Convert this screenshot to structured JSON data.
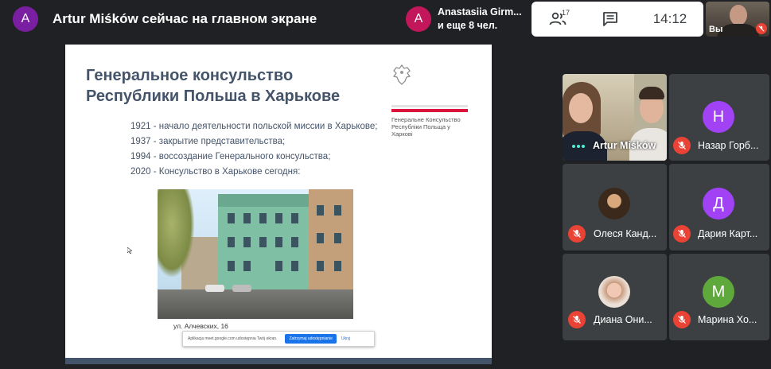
{
  "presenting": {
    "avatar_letter": "A",
    "avatar_color": "#7b1fa2",
    "label": "Artur Miśków сейчас на главном экране"
  },
  "chip": {
    "avatar_letter": "A",
    "avatar_color": "#c2185b",
    "line1": "Anastasiia Girm...",
    "line2": "и еще 8 чел."
  },
  "controls": {
    "people_count": "17",
    "time": "14:12"
  },
  "self_view": {
    "label": "Вы"
  },
  "slide": {
    "title": "Генеральное консульство Республики Польша в Харькове",
    "crest_caption": "Генеральне Консульство Республіки Польща у Харкові",
    "timeline": [
      "1921 - начало деятельности польской миссии в Харькове;",
      "1937 - закрытие представительства;",
      "1994 - воссоздание Генерального консульства;",
      "2020 - Консульство в Харькове сегодня:"
    ],
    "photo_caption": "ул. Алчевских, 16",
    "share_bar": {
      "text": "Aplikacja meet.google.com udostępnia Twój ekran.",
      "stop_label": "Zatrzymaj udostępnianie",
      "hide_label": "Ukryj"
    }
  },
  "participants": [
    {
      "name": "Artur Miśków",
      "type": "video"
    },
    {
      "name": "Назар Горб...",
      "letter": "Н",
      "color": "#a142f4",
      "muted": true
    },
    {
      "name": "Олеся Канд...",
      "letter": "",
      "color": "#5a4632",
      "muted": true,
      "photo": true
    },
    {
      "name": "Дария Карт...",
      "letter": "Д",
      "color": "#a142f4",
      "muted": true
    },
    {
      "name": "Диана Они...",
      "letter": "",
      "color": "#d9b9a6",
      "muted": true,
      "photo": true
    },
    {
      "name": "Марина Хо...",
      "letter": "М",
      "color": "#5fa83b",
      "muted": true
    }
  ],
  "colors": {
    "background": "#202124",
    "tile": "#3c4043",
    "muted_red": "#ea4335",
    "slide_text": "#44546a"
  }
}
